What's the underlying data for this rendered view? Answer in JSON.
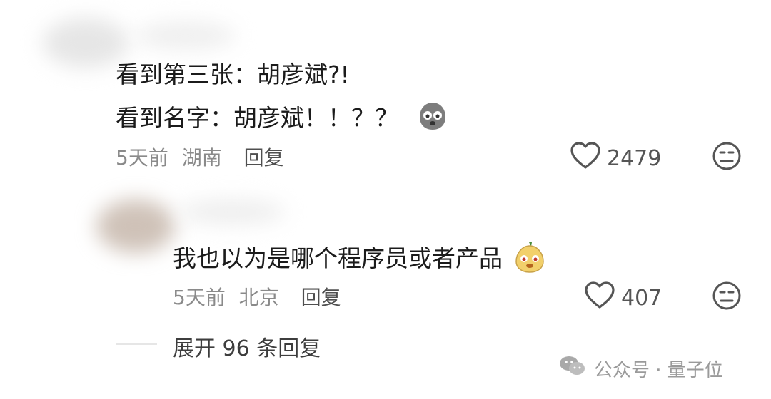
{
  "comments": [
    {
      "lines": [
        "看到第三张：胡彦斌?!",
        "看到名字：胡彦斌！！？？"
      ],
      "time": "5天前",
      "location": "湖南",
      "reply_label": "回复",
      "likes": "2479",
      "emoji": "sad-face-emoji"
    },
    {
      "text": "我也以为是哪个程序员或者产品",
      "time": "5天前",
      "location": "北京",
      "reply_label": "回复",
      "likes": "407",
      "emoji": "pear-face-emoji"
    }
  ],
  "expand_label": "展开 96 条回复",
  "watermark": "公众号 · 量子位",
  "colors": {
    "text": "#1b1b1b",
    "meta": "#8a8a8a",
    "icon": "#555555"
  }
}
